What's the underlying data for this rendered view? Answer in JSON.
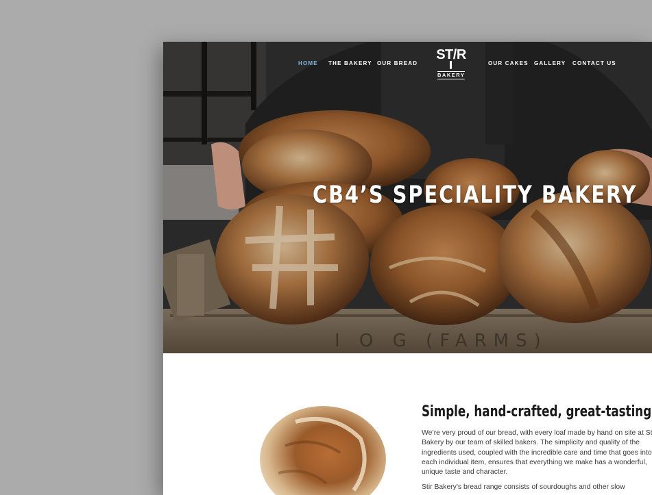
{
  "nav": {
    "items": [
      {
        "label": "HOME",
        "active": true
      },
      {
        "label": "THE BAKERY",
        "active": false
      },
      {
        "label": "OUR BREAD",
        "active": false
      },
      {
        "label": "OUR CAKES",
        "active": false
      },
      {
        "label": "GALLERY",
        "active": false
      },
      {
        "label": "CONTACT US",
        "active": false
      }
    ],
    "active_color": "#7fb4dc"
  },
  "logo": {
    "line1": "ST/R",
    "line2": "BAKERY"
  },
  "hero": {
    "title": "CB4’S SPECIALITY BAKERY",
    "image": "bread-crate-photo"
  },
  "intro": {
    "heading": "Simple, hand-crafted, great-tasting bread",
    "paragraph1": "We’re very proud of our bread, with every loaf made by hand on site at Stir Bakery by our team of skilled bakers. The simplicity and quality of the ingredients used, coupled with the incredible care and time that goes into each individual item, ensures that everything we make has a wonderful, unique taste and character.",
    "paragraph2": "Stir Bakery’s bread range consists of sourdoughs and other slow",
    "image": "sourdough-loaf-photo"
  }
}
